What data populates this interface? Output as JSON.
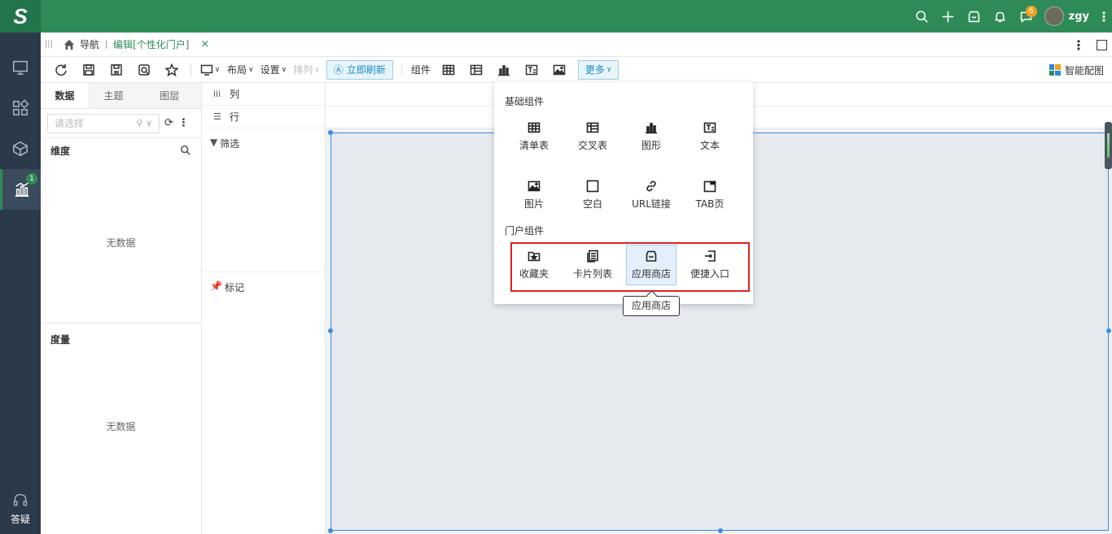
{
  "topbar": {
    "logo": "S",
    "username": "zgy",
    "message_badge": "6"
  },
  "leftnav": {
    "active_badge": "1",
    "help_label": "答疑"
  },
  "tabbar": {
    "nav_label": "导航",
    "edit_tab_label": "编辑[个性化门户]",
    "close_symbol": "×"
  },
  "toolbar": {
    "layout_label": "布局",
    "settings_label": "设置",
    "arrange_label": "排列",
    "refresh_label": "立即刷新",
    "component_label": "组件",
    "more_label": "更多",
    "smart_label": "智能配图"
  },
  "datapanel": {
    "tabs": [
      "数据",
      "主题",
      "图层"
    ],
    "select_placeholder": "请选择",
    "dimension_title": "维度",
    "measure_title": "度量",
    "no_data": "无数据"
  },
  "shelf": {
    "column_label": "列",
    "row_label": "行",
    "filter_label": "筛选",
    "mark_label": "标记"
  },
  "popup": {
    "basic_title": "基础组件",
    "portal_title": "门户组件",
    "basic_items": [
      {
        "label": "清单表",
        "icon": "table-icon"
      },
      {
        "label": "交叉表",
        "icon": "crosstab-icon"
      },
      {
        "label": "图形",
        "icon": "bar-chart-icon"
      },
      {
        "label": "文本",
        "icon": "text-icon"
      },
      {
        "label": "图片",
        "icon": "image-icon"
      },
      {
        "label": "空白",
        "icon": "blank-icon"
      },
      {
        "label": "URL链接",
        "icon": "link-icon"
      },
      {
        "label": "TAB页",
        "icon": "tab-icon"
      }
    ],
    "portal_items": [
      {
        "label": "收藏夹",
        "icon": "favorites-icon"
      },
      {
        "label": "卡片列表",
        "icon": "card-list-icon"
      },
      {
        "label": "应用商店",
        "icon": "app-store-icon"
      },
      {
        "label": "便捷入口",
        "icon": "shortcut-icon"
      }
    ],
    "tooltip": "应用商店"
  },
  "colors": {
    "brand": "#2e8b57",
    "nav_bg": "#2b3a4a",
    "accent_blue": "#1a8ac6",
    "highlight_red": "#e02020"
  }
}
